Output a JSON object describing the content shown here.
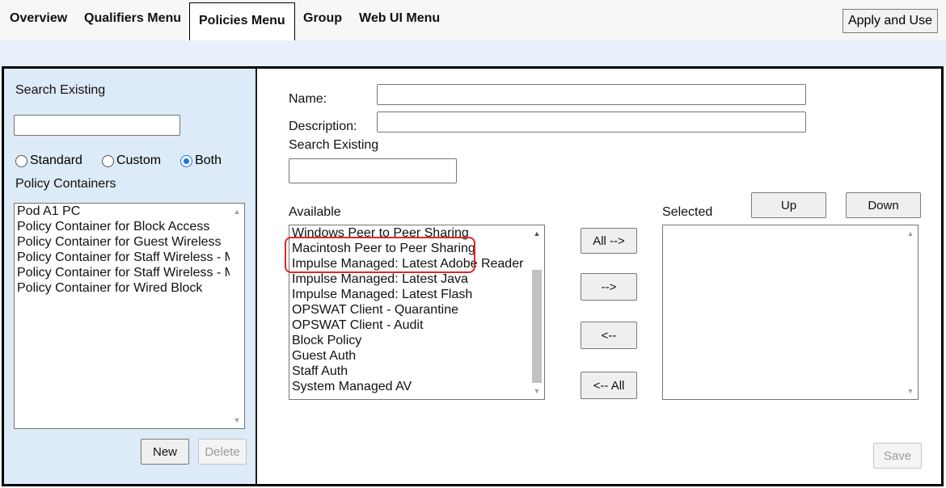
{
  "menu": {
    "tabs": [
      "Overview",
      "Qualifiers Menu",
      "Policies Menu",
      "Group",
      "Web UI Menu"
    ],
    "active_tab": "Policies Menu",
    "apply_label": "Apply and Use"
  },
  "left_panel": {
    "search_label": "Search Existing",
    "search_value": "",
    "radio_options": [
      "Standard",
      "Custom",
      "Both"
    ],
    "radio_selected": "Both",
    "containers_label": "Policy Containers",
    "containers": [
      "Pod A1 PC",
      "Policy Container for Block Access",
      "Policy Container for Guest Wireless",
      "Policy Container for Staff Wireless - M",
      "Policy Container for Staff Wireless - M",
      "Policy Container for Wired Block"
    ],
    "new_label": "New",
    "delete_label": "Delete"
  },
  "right_panel": {
    "name_label": "Name:",
    "name_value": "",
    "description_label": "Description:",
    "description_value": "",
    "search_label": "Search Existing",
    "search_value": "",
    "available_label": "Available",
    "available_items": [
      "Windows Peer to Peer Sharing",
      "Macintosh Peer to Peer Sharing",
      "Impulse Managed: Latest Adobe Reader",
      "Impulse Managed: Latest Java",
      "Impulse Managed: Latest Flash",
      "OPSWAT Client - Quarantine",
      "OPSWAT Client - Audit",
      "Block Policy",
      "Guest Auth",
      "Staff Auth",
      "System Managed AV"
    ],
    "highlighted_items": [
      "OPSWAT Client - Quarantine",
      "OPSWAT Client - Audit"
    ],
    "highlight_color": "#d92a2a",
    "move_buttons": {
      "all_right": "All -->",
      "right": "-->",
      "left": "<--",
      "all_left": "<-- All"
    },
    "selected_label": "Selected",
    "selected_items": [],
    "up_label": "Up",
    "down_label": "Down",
    "save_label": "Save"
  }
}
